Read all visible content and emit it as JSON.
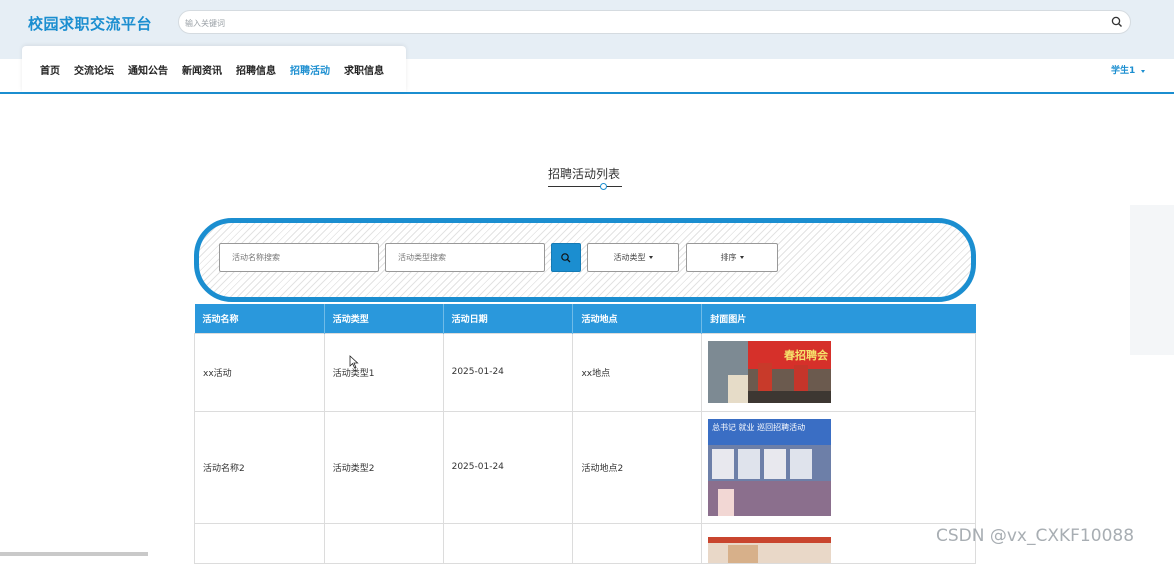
{
  "header": {
    "site_title": "校园求职交流平台",
    "search_placeholder": "输入关键词"
  },
  "nav": {
    "items": [
      {
        "label": "首页"
      },
      {
        "label": "交流论坛"
      },
      {
        "label": "通知公告"
      },
      {
        "label": "新闻资讯"
      },
      {
        "label": "招聘信息"
      },
      {
        "label": "招聘活动",
        "active": true
      },
      {
        "label": "求职信息"
      }
    ],
    "user": "学生1"
  },
  "section": {
    "title": "招聘活动列表"
  },
  "filters": {
    "name_placeholder": "活动名称搜索",
    "type_placeholder": "活动类型搜索",
    "type_dropdown": "活动类型",
    "sort_dropdown": "排序"
  },
  "table": {
    "headers": [
      "活动名称",
      "活动类型",
      "活动日期",
      "活动地点",
      "封面图片"
    ],
    "rows": [
      {
        "name": "xx活动",
        "type": "活动类型1",
        "date": "2025-01-24",
        "place": "xx地点",
        "image_caption": "春招聘会"
      },
      {
        "name": "活动名称2",
        "type": "活动类型2",
        "date": "2025-01-24",
        "place": "活动地点2",
        "image_caption": "总书记 就业 巡回招聘活动"
      },
      {
        "name": "",
        "type": "",
        "date": "",
        "place": "",
        "image_caption": ""
      }
    ]
  },
  "watermark": "CSDN @vx_CXKF10088",
  "colors": {
    "accent": "#1b8ed0",
    "header_bg": "#e6eef5",
    "table_header": "#2a98dc"
  }
}
